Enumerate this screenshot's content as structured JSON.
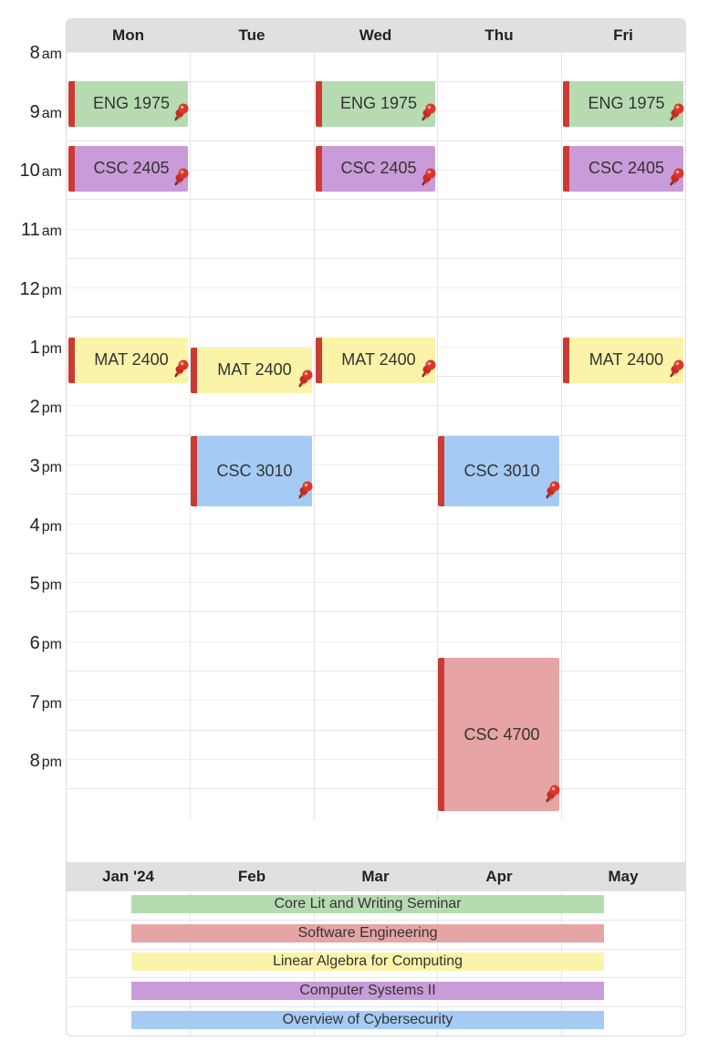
{
  "colors": {
    "green": "#b6dbb1",
    "purple": "#c99bd8",
    "yellow": "#fbf4a8",
    "blue": "#a5cbf4",
    "red": "#e6a4a4",
    "accent_bar": "#cc3b33",
    "header_bg": "#e0e0e0"
  },
  "time_labels": [
    {
      "num": "8",
      "ap": "am"
    },
    {
      "num": "9",
      "ap": "am"
    },
    {
      "num": "10",
      "ap": "am"
    },
    {
      "num": "11",
      "ap": "am"
    },
    {
      "num": "12",
      "ap": "pm"
    },
    {
      "num": "1",
      "ap": "pm"
    },
    {
      "num": "2",
      "ap": "pm"
    },
    {
      "num": "3",
      "ap": "pm"
    },
    {
      "num": "4",
      "ap": "pm"
    },
    {
      "num": "5",
      "ap": "pm"
    },
    {
      "num": "6",
      "ap": "pm"
    },
    {
      "num": "7",
      "ap": "pm"
    },
    {
      "num": "8",
      "ap": "pm"
    }
  ],
  "days": [
    "Mon",
    "Tue",
    "Wed",
    "Thu",
    "Fri"
  ],
  "events": [
    {
      "label": "ENG 1975",
      "color": "green",
      "icon": "pushpin-icon"
    },
    {
      "label": "ENG 1975",
      "color": "green",
      "icon": "pushpin-icon"
    },
    {
      "label": "ENG 1975",
      "color": "green",
      "icon": "pushpin-icon"
    },
    {
      "label": "CSC 2405",
      "color": "purple",
      "icon": "pushpin-icon"
    },
    {
      "label": "CSC 2405",
      "color": "purple",
      "icon": "pushpin-icon"
    },
    {
      "label": "CSC 2405",
      "color": "purple",
      "icon": "pushpin-icon"
    },
    {
      "label": "MAT 2400",
      "color": "yellow",
      "icon": "pushpin-icon"
    },
    {
      "label": "MAT 2400",
      "color": "yellow",
      "icon": "pushpin-icon"
    },
    {
      "label": "MAT 2400",
      "color": "yellow",
      "icon": "pushpin-icon"
    },
    {
      "label": "MAT 2400",
      "color": "yellow",
      "icon": "pushpin-icon"
    },
    {
      "label": "CSC 3010",
      "color": "blue",
      "icon": "pushpin-icon"
    },
    {
      "label": "CSC 3010",
      "color": "blue",
      "icon": "pushpin-icon"
    },
    {
      "label": "CSC 4700",
      "color": "red",
      "icon": "pushpin-icon"
    }
  ],
  "timeline": {
    "months": [
      "Jan '24",
      "Feb",
      "Mar",
      "Apr",
      "May"
    ],
    "courses": [
      {
        "label": "Core Lit and Writing Seminar",
        "color": "green"
      },
      {
        "label": "Software Engineering",
        "color": "red"
      },
      {
        "label": "Linear Algebra for Computing",
        "color": "yellow"
      },
      {
        "label": "Computer Systems II",
        "color": "purple"
      },
      {
        "label": "Overview of Cybersecurity",
        "color": "blue"
      }
    ]
  }
}
